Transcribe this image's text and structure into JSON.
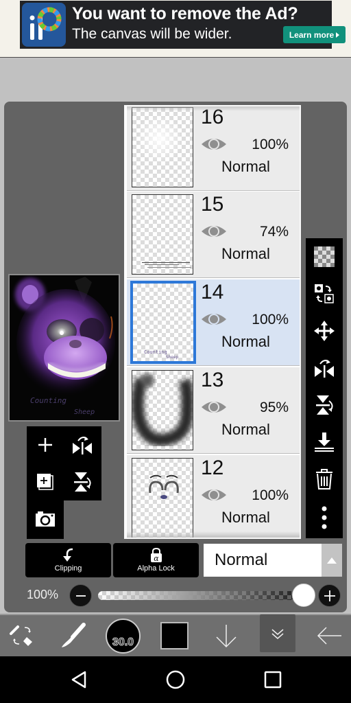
{
  "ad": {
    "title": "You want to remove the Ad?",
    "subtitle": "The canvas will be wider.",
    "button": "Learn more",
    "logo_icon": "ibispaint-logo-icon"
  },
  "layers": [
    {
      "number": "16",
      "opacity": "100%",
      "mode": "Normal",
      "visible": true,
      "selected": false
    },
    {
      "number": "15",
      "opacity": "74%",
      "mode": "Normal",
      "visible": true,
      "selected": false
    },
    {
      "number": "14",
      "opacity": "100%",
      "mode": "Normal",
      "visible": true,
      "selected": true
    },
    {
      "number": "13",
      "opacity": "95%",
      "mode": "Normal",
      "visible": true,
      "selected": false
    },
    {
      "number": "12",
      "opacity": "100%",
      "mode": "Normal",
      "visible": true,
      "selected": false
    }
  ],
  "preview": {
    "caption_line1": "Counting",
    "caption_line2": "Sheep"
  },
  "left_tools": [
    "add-layer",
    "flip-horizontal",
    "duplicate-layer",
    "flip-vertical",
    "camera-import"
  ],
  "right_tools": [
    "transparency",
    "swap-layers",
    "move",
    "flip-horizontal",
    "flip-vertical",
    "merge-down",
    "delete",
    "more"
  ],
  "controls": {
    "clipping_label": "Clipping",
    "alpha_lock_label": "Alpha Lock",
    "blend_mode": "Normal",
    "opacity_label": "100%",
    "opacity_value": 100
  },
  "toolbar": {
    "brush_size": "30.0",
    "color": "#000000"
  },
  "colors": {
    "selected_layer_bg": "#d8e3f3",
    "selected_border": "#2d78d8",
    "ad_button": "#11917c"
  }
}
